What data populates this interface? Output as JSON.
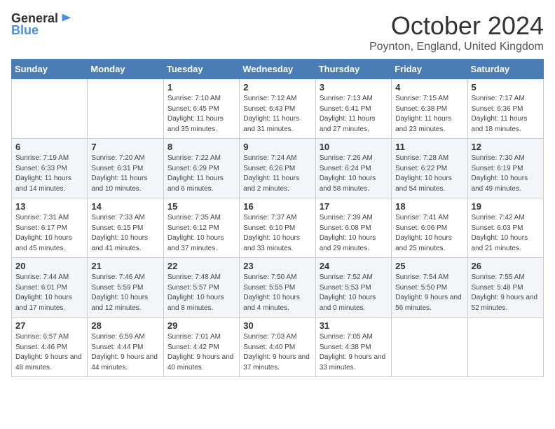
{
  "logo": {
    "general": "General",
    "blue": "Blue"
  },
  "title": "October 2024",
  "location": "Poynton, England, United Kingdom",
  "days_of_week": [
    "Sunday",
    "Monday",
    "Tuesday",
    "Wednesday",
    "Thursday",
    "Friday",
    "Saturday"
  ],
  "weeks": [
    [
      {
        "day": "",
        "info": ""
      },
      {
        "day": "",
        "info": ""
      },
      {
        "day": "1",
        "info": "Sunrise: 7:10 AM\nSunset: 6:45 PM\nDaylight: 11 hours\nand 35 minutes."
      },
      {
        "day": "2",
        "info": "Sunrise: 7:12 AM\nSunset: 6:43 PM\nDaylight: 11 hours\nand 31 minutes."
      },
      {
        "day": "3",
        "info": "Sunrise: 7:13 AM\nSunset: 6:41 PM\nDaylight: 11 hours\nand 27 minutes."
      },
      {
        "day": "4",
        "info": "Sunrise: 7:15 AM\nSunset: 6:38 PM\nDaylight: 11 hours\nand 23 minutes."
      },
      {
        "day": "5",
        "info": "Sunrise: 7:17 AM\nSunset: 6:36 PM\nDaylight: 11 hours\nand 18 minutes."
      }
    ],
    [
      {
        "day": "6",
        "info": "Sunrise: 7:19 AM\nSunset: 6:33 PM\nDaylight: 11 hours\nand 14 minutes."
      },
      {
        "day": "7",
        "info": "Sunrise: 7:20 AM\nSunset: 6:31 PM\nDaylight: 11 hours\nand 10 minutes."
      },
      {
        "day": "8",
        "info": "Sunrise: 7:22 AM\nSunset: 6:29 PM\nDaylight: 11 hours\nand 6 minutes."
      },
      {
        "day": "9",
        "info": "Sunrise: 7:24 AM\nSunset: 6:26 PM\nDaylight: 11 hours\nand 2 minutes."
      },
      {
        "day": "10",
        "info": "Sunrise: 7:26 AM\nSunset: 6:24 PM\nDaylight: 10 hours\nand 58 minutes."
      },
      {
        "day": "11",
        "info": "Sunrise: 7:28 AM\nSunset: 6:22 PM\nDaylight: 10 hours\nand 54 minutes."
      },
      {
        "day": "12",
        "info": "Sunrise: 7:30 AM\nSunset: 6:19 PM\nDaylight: 10 hours\nand 49 minutes."
      }
    ],
    [
      {
        "day": "13",
        "info": "Sunrise: 7:31 AM\nSunset: 6:17 PM\nDaylight: 10 hours\nand 45 minutes."
      },
      {
        "day": "14",
        "info": "Sunrise: 7:33 AM\nSunset: 6:15 PM\nDaylight: 10 hours\nand 41 minutes."
      },
      {
        "day": "15",
        "info": "Sunrise: 7:35 AM\nSunset: 6:12 PM\nDaylight: 10 hours\nand 37 minutes."
      },
      {
        "day": "16",
        "info": "Sunrise: 7:37 AM\nSunset: 6:10 PM\nDaylight: 10 hours\nand 33 minutes."
      },
      {
        "day": "17",
        "info": "Sunrise: 7:39 AM\nSunset: 6:08 PM\nDaylight: 10 hours\nand 29 minutes."
      },
      {
        "day": "18",
        "info": "Sunrise: 7:41 AM\nSunset: 6:06 PM\nDaylight: 10 hours\nand 25 minutes."
      },
      {
        "day": "19",
        "info": "Sunrise: 7:42 AM\nSunset: 6:03 PM\nDaylight: 10 hours\nand 21 minutes."
      }
    ],
    [
      {
        "day": "20",
        "info": "Sunrise: 7:44 AM\nSunset: 6:01 PM\nDaylight: 10 hours\nand 17 minutes."
      },
      {
        "day": "21",
        "info": "Sunrise: 7:46 AM\nSunset: 5:59 PM\nDaylight: 10 hours\nand 12 minutes."
      },
      {
        "day": "22",
        "info": "Sunrise: 7:48 AM\nSunset: 5:57 PM\nDaylight: 10 hours\nand 8 minutes."
      },
      {
        "day": "23",
        "info": "Sunrise: 7:50 AM\nSunset: 5:55 PM\nDaylight: 10 hours\nand 4 minutes."
      },
      {
        "day": "24",
        "info": "Sunrise: 7:52 AM\nSunset: 5:53 PM\nDaylight: 10 hours\nand 0 minutes."
      },
      {
        "day": "25",
        "info": "Sunrise: 7:54 AM\nSunset: 5:50 PM\nDaylight: 9 hours\nand 56 minutes."
      },
      {
        "day": "26",
        "info": "Sunrise: 7:55 AM\nSunset: 5:48 PM\nDaylight: 9 hours\nand 52 minutes."
      }
    ],
    [
      {
        "day": "27",
        "info": "Sunrise: 6:57 AM\nSunset: 4:46 PM\nDaylight: 9 hours\nand 48 minutes."
      },
      {
        "day": "28",
        "info": "Sunrise: 6:59 AM\nSunset: 4:44 PM\nDaylight: 9 hours\nand 44 minutes."
      },
      {
        "day": "29",
        "info": "Sunrise: 7:01 AM\nSunset: 4:42 PM\nDaylight: 9 hours\nand 40 minutes."
      },
      {
        "day": "30",
        "info": "Sunrise: 7:03 AM\nSunset: 4:40 PM\nDaylight: 9 hours\nand 37 minutes."
      },
      {
        "day": "31",
        "info": "Sunrise: 7:05 AM\nSunset: 4:38 PM\nDaylight: 9 hours\nand 33 minutes."
      },
      {
        "day": "",
        "info": ""
      },
      {
        "day": "",
        "info": ""
      }
    ]
  ]
}
